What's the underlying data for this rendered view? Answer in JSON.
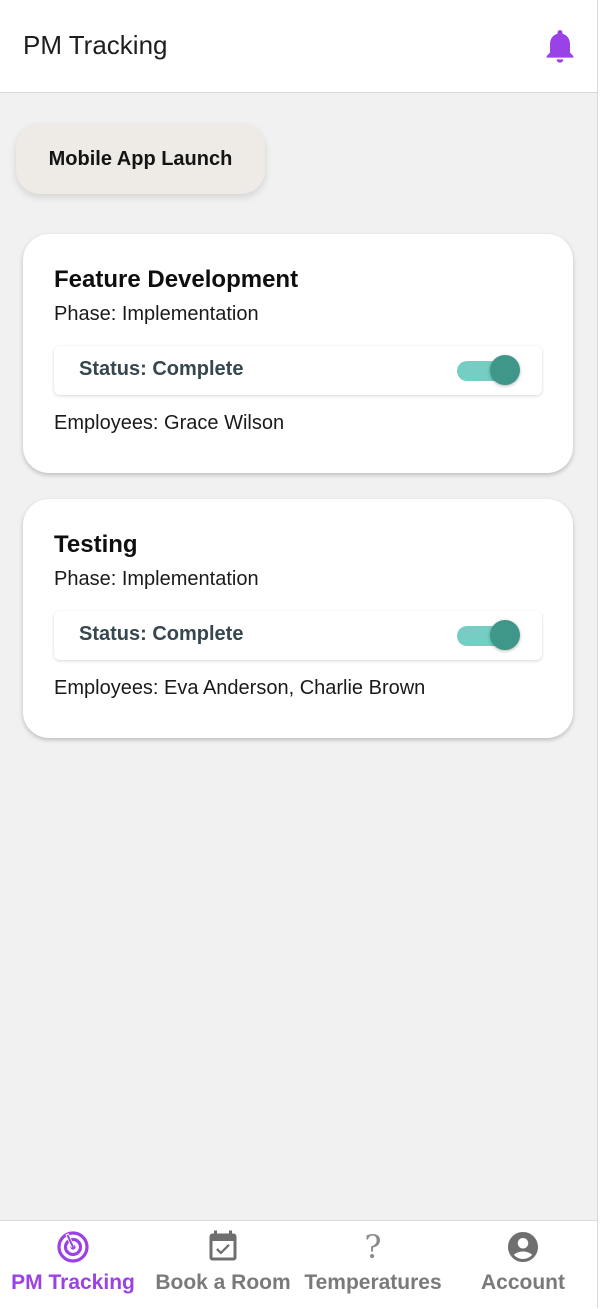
{
  "header": {
    "title": "PM Tracking",
    "notification_icon": "bell-icon"
  },
  "project": {
    "name": "Mobile App Launch"
  },
  "tasks": [
    {
      "title": "Feature Development",
      "phase": "Phase: Implementation",
      "status": "Status: Complete",
      "status_on": true,
      "employees": "Employees: Grace Wilson"
    },
    {
      "title": "Testing",
      "phase": "Phase: Implementation",
      "status": "Status: Complete",
      "status_on": true,
      "employees": "Employees: Eva Anderson, Charlie Brown"
    }
  ],
  "nav": {
    "items": [
      {
        "label": "PM Tracking",
        "icon": "target-icon",
        "active": true
      },
      {
        "label": "Book a Room",
        "icon": "calendar-check-icon",
        "active": false
      },
      {
        "label": "Temperatures",
        "icon": "question-icon",
        "active": false
      },
      {
        "label": "Account",
        "icon": "account-circle-icon",
        "active": false
      }
    ]
  },
  "colors": {
    "accent": "#9a42e6",
    "toggle_track": "#75cdc3",
    "toggle_knob": "#3f978a",
    "background": "#f1f1f1"
  }
}
